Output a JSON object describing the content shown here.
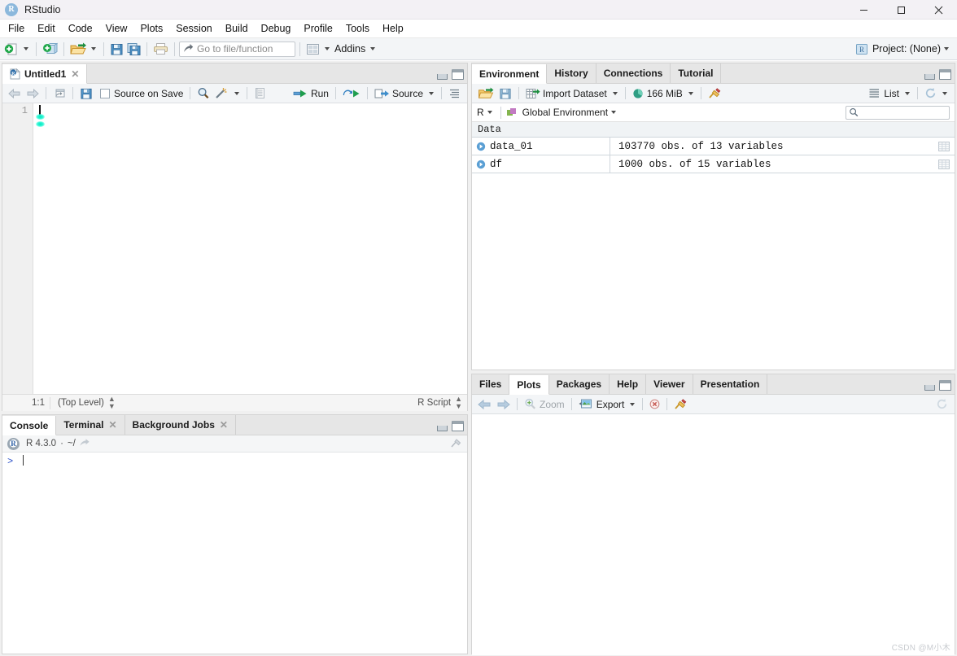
{
  "window": {
    "title": "RStudio",
    "logo_letter": "R",
    "controls": {
      "minimize": "—",
      "maximize": "□",
      "close": "✕"
    }
  },
  "menubar": {
    "items": [
      "File",
      "Edit",
      "Code",
      "View",
      "Plots",
      "Session",
      "Build",
      "Debug",
      "Profile",
      "Tools",
      "Help"
    ]
  },
  "toolbar": {
    "new_file_label": "new-file",
    "new_project_label": "new-project",
    "open_label": "open-file",
    "save_label": "save",
    "save_all_label": "save-all",
    "print_label": "print",
    "goto_placeholder": "Go to file/function",
    "panes_label": "workspace-panes",
    "addins_label": "Addins",
    "project_label": "Project: (None)"
  },
  "source_pane": {
    "tabs": [
      {
        "label": "Untitled1",
        "closable": true,
        "active": true
      }
    ],
    "toolbar": {
      "back": "back",
      "forward": "forward",
      "popout": "show-in-new-window",
      "save": "save",
      "source_on_save_label": "Source on Save",
      "source_on_save_checked": false,
      "find": "find-replace",
      "magic": "code-tools",
      "compile_report": "compile-report",
      "run_label": "Run",
      "rerun": "re-run",
      "source_label": "Source",
      "outline": "document-outline"
    },
    "editor": {
      "line_numbers": [
        "1"
      ],
      "lines": [
        ""
      ],
      "cursor_visible": true
    },
    "status": {
      "position": "1:1",
      "scope": "(Top Level)",
      "language": "R Script"
    }
  },
  "console_pane": {
    "tabs": [
      {
        "label": "Console",
        "closable": false,
        "active": true
      },
      {
        "label": "Terminal",
        "closable": true,
        "active": false
      },
      {
        "label": "Background Jobs",
        "closable": true,
        "active": false
      }
    ],
    "info": {
      "r_version": "R 4.3.0",
      "separator": "·",
      "working_dir": "~/"
    },
    "prompt": ">"
  },
  "environment_pane": {
    "tabs": [
      {
        "label": "Environment",
        "active": true
      },
      {
        "label": "History",
        "active": false
      },
      {
        "label": "Connections",
        "active": false
      },
      {
        "label": "Tutorial",
        "active": false
      }
    ],
    "toolbar": {
      "load_workspace": "load-workspace",
      "save_workspace": "save-workspace",
      "import_dataset_label": "Import Dataset",
      "memory_label": "166 MiB",
      "clear_label": "clear-objects",
      "view_mode_label": "List",
      "refresh_label": "refresh"
    },
    "selector": {
      "language": "R",
      "environment": "Global Environment",
      "search_placeholder": ""
    },
    "group_header": "Data",
    "objects": [
      {
        "name": "data_01",
        "description": "103770 obs. of 13 variables",
        "has_grid": true
      },
      {
        "name": "df",
        "description": "1000 obs. of 15 variables",
        "has_grid": true
      }
    ]
  },
  "files_pane": {
    "tabs": [
      {
        "label": "Files",
        "active": false
      },
      {
        "label": "Plots",
        "active": true
      },
      {
        "label": "Packages",
        "active": false
      },
      {
        "label": "Help",
        "active": false
      },
      {
        "label": "Viewer",
        "active": false
      },
      {
        "label": "Presentation",
        "active": false
      }
    ],
    "toolbar": {
      "back": "previous-plot",
      "forward": "next-plot",
      "zoom_label": "Zoom",
      "export_label": "Export",
      "remove_label": "remove-plot",
      "clear_label": "clear-all-plots",
      "refresh_label": "refresh"
    }
  },
  "watermark": "CSDN @M小木"
}
